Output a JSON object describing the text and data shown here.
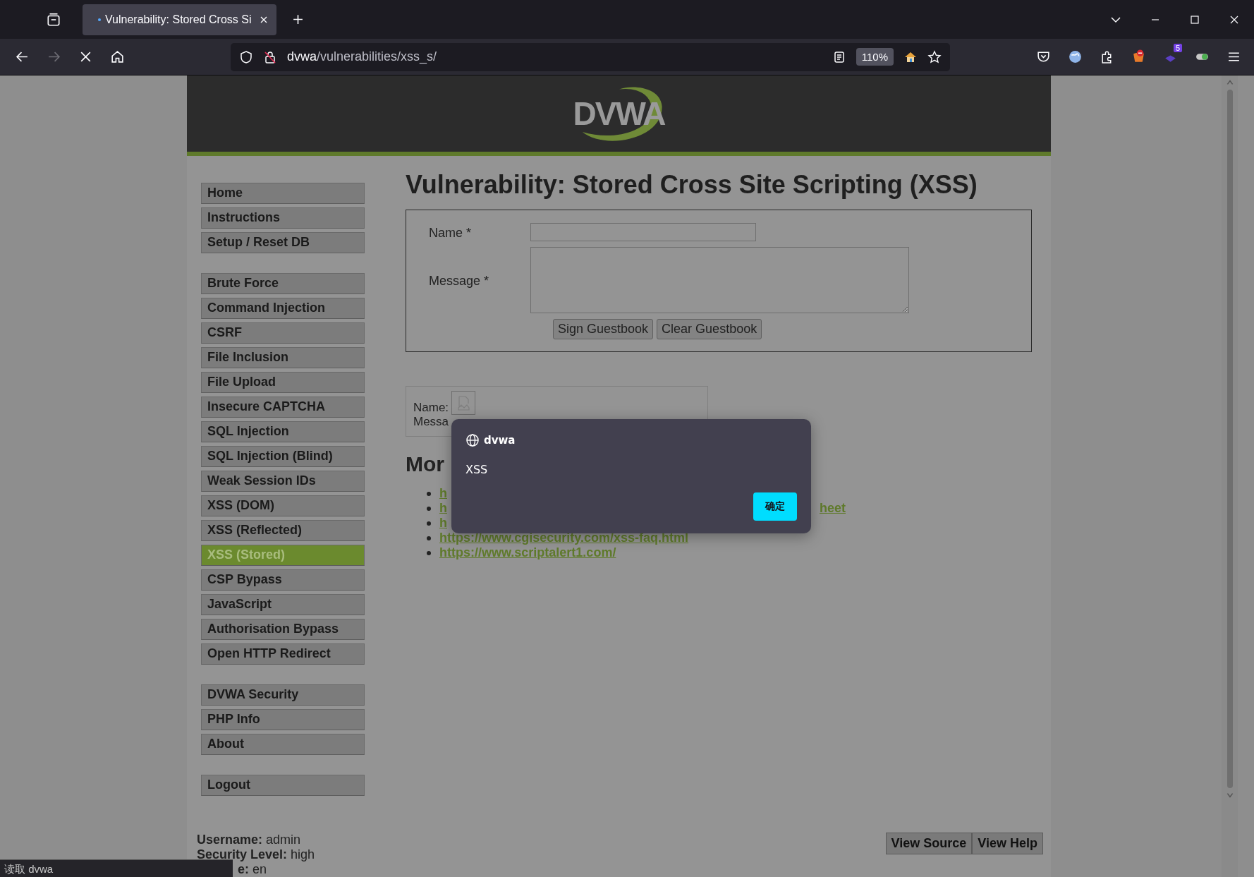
{
  "browser": {
    "tab_title": "Vulnerability: Stored Cross Si",
    "url_host": "dvwa",
    "url_path": "/vulnerabilities/xss_s/",
    "zoom": "110%",
    "extension_badge": "5",
    "forward_disabled": true
  },
  "header": {
    "logo": "DVWA"
  },
  "sidebar": {
    "groups": [
      [
        {
          "label": "Home",
          "selected": false
        },
        {
          "label": "Instructions",
          "selected": false
        },
        {
          "label": "Setup / Reset DB",
          "selected": false
        }
      ],
      [
        {
          "label": "Brute Force",
          "selected": false
        },
        {
          "label": "Command Injection",
          "selected": false
        },
        {
          "label": "CSRF",
          "selected": false
        },
        {
          "label": "File Inclusion",
          "selected": false
        },
        {
          "label": "File Upload",
          "selected": false
        },
        {
          "label": "Insecure CAPTCHA",
          "selected": false
        },
        {
          "label": "SQL Injection",
          "selected": false
        },
        {
          "label": "SQL Injection (Blind)",
          "selected": false
        },
        {
          "label": "Weak Session IDs",
          "selected": false
        },
        {
          "label": "XSS (DOM)",
          "selected": false
        },
        {
          "label": "XSS (Reflected)",
          "selected": false
        },
        {
          "label": "XSS (Stored)",
          "selected": true
        },
        {
          "label": "CSP Bypass",
          "selected": false
        },
        {
          "label": "JavaScript",
          "selected": false
        },
        {
          "label": "Authorisation Bypass",
          "selected": false
        },
        {
          "label": "Open HTTP Redirect",
          "selected": false
        }
      ],
      [
        {
          "label": "DVWA Security",
          "selected": false
        },
        {
          "label": "PHP Info",
          "selected": false
        },
        {
          "label": "About",
          "selected": false
        }
      ],
      [
        {
          "label": "Logout",
          "selected": false
        }
      ]
    ]
  },
  "main": {
    "title": "Vulnerability: Stored Cross Site Scripting (XSS)",
    "form": {
      "name_label": "Name *",
      "message_label": "Message *",
      "buttons": [
        "Sign Guestbook",
        "Clear Guestbook"
      ]
    },
    "entry": {
      "name_label": "Name:",
      "message_label": "Messa"
    },
    "more_heading": "Mor",
    "links": [
      {
        "text": "h"
      },
      {
        "text": "h",
        "tail": "heet"
      },
      {
        "text": "h"
      },
      {
        "text": "https://www.cgisecurity.com/xss-faq.html"
      },
      {
        "text": "https://www.scriptalert1.com/"
      }
    ]
  },
  "footer": {
    "lines": [
      {
        "text": "**Username:** admin",
        "covered": false
      },
      {
        "text": "**Security Level:** high",
        "covered": false
      },
      {
        "text": "**e:** en",
        "covered": true
      }
    ],
    "buttons": [
      "View Source",
      "View Help"
    ]
  },
  "status_bar": "读取 dvwa",
  "dialog": {
    "site": "dvwa",
    "message": "XSS",
    "ok": "确定"
  }
}
